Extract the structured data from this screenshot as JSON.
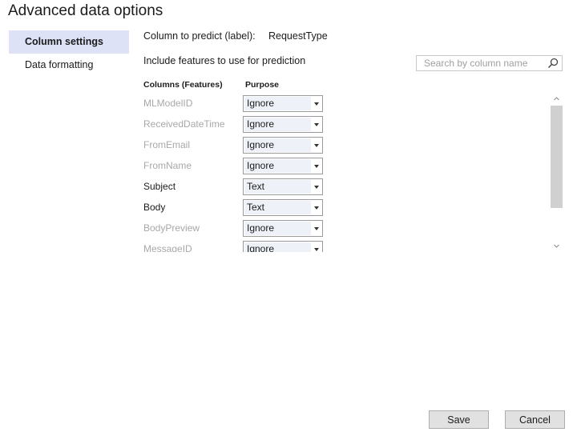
{
  "dialog": {
    "title": "Advanced data options"
  },
  "nav": {
    "items": [
      {
        "label": "Column settings",
        "active": true
      },
      {
        "label": "Data formatting",
        "active": false
      }
    ]
  },
  "label_row": {
    "label": "Column to predict (label):",
    "value": "RequestType"
  },
  "include": {
    "text": "Include features to use for prediction"
  },
  "search": {
    "placeholder": "Search by column name",
    "value": ""
  },
  "table": {
    "headers": {
      "columns": "Columns (Features)",
      "purpose": "Purpose"
    },
    "rows": [
      {
        "name": "MLModelID",
        "purpose": "Ignore",
        "enabled": false
      },
      {
        "name": "ReceivedDateTime",
        "purpose": "Ignore",
        "enabled": false
      },
      {
        "name": "FromEmail",
        "purpose": "Ignore",
        "enabled": false
      },
      {
        "name": "FromName",
        "purpose": "Ignore",
        "enabled": false
      },
      {
        "name": "Subject",
        "purpose": "Text",
        "enabled": true
      },
      {
        "name": "Body",
        "purpose": "Text",
        "enabled": true
      },
      {
        "name": "BodyPreview",
        "purpose": "Ignore",
        "enabled": false
      },
      {
        "name": "MessageID",
        "purpose": "Ignore",
        "enabled": false
      }
    ]
  },
  "footer": {
    "save_label": "Save",
    "cancel_label": "Cancel"
  }
}
